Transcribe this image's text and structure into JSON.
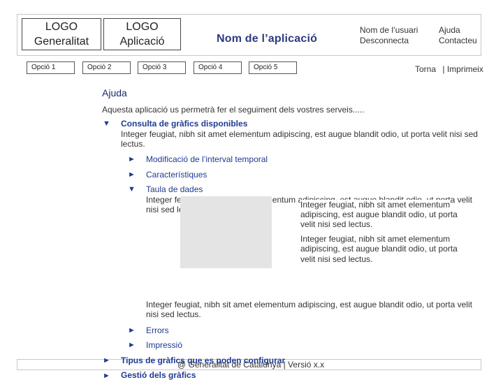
{
  "header": {
    "logo_generalitat": {
      "line1": "LOGO",
      "line2": "Generalitat"
    },
    "logo_aplicacio": {
      "line1": "LOGO",
      "line2": "Aplicació"
    },
    "app_title": "Nom de l’aplicació",
    "user": {
      "username": "Nom de l’usuari",
      "logout": "Desconnecta",
      "help": "Ajuda",
      "contact": "Contacteu"
    }
  },
  "nav": {
    "tabs": [
      {
        "label": "Opció 1"
      },
      {
        "label": "Opció 2"
      },
      {
        "label": "Opció 3"
      },
      {
        "label": "Opció 4"
      },
      {
        "label": "Opció 5"
      }
    ],
    "back": "Torna",
    "separator": "|",
    "print": "Imprimeix"
  },
  "help": {
    "title": "Ajuda",
    "intro": "Aquesta aplicació us permetrà fer el seguiment dels vostres serveis.....",
    "sections": {
      "consulta": {
        "arrow": "▼",
        "title": "Consulta de gràfics disponibles",
        "body_line1": "Integer feugiat, nibh sit amet elementum adipiscing, est augue blandit odio, ut porta velit nisi sed",
        "body_line2": "lectus."
      },
      "modificacio": {
        "arrow": "►",
        "label": "Modificació de l’interval temporal"
      },
      "caracteristiques": {
        "arrow": "►",
        "label": "Característiques"
      },
      "taula": {
        "arrow": "▼",
        "label": "Taula de dades",
        "back_line1": "Integer feugiat, nibh sit amet elementum adipiscing, est augue blandit odio, ut porta velit",
        "back_line2": "nisi sed lectus.",
        "col_p1_l1": "Integer feugiat, nibh sit amet elementum",
        "col_p1_l2": "adipiscing, est augue blandit odio, ut porta",
        "col_p1_l3": "velit nisi sed lectus.",
        "col_p2_l1": "Integer feugiat, nibh sit amet elementum",
        "col_p2_l2": "adipiscing, est augue blandit odio, ut porta",
        "col_p2_l3": "velit nisi sed lectus.",
        "after_line1": "Integer feugiat, nibh sit amet elementum adipiscing, est augue blandit odio, ut porta velit",
        "after_line2": "nisi sed lectus."
      },
      "errors": {
        "arrow": "►",
        "label": "Errors"
      },
      "impressio": {
        "arrow": "►",
        "label": "Impressió"
      },
      "tipus": {
        "arrow": "►",
        "label": "Tipus de gràfics que es poden configurar"
      },
      "gestio": {
        "arrow": "►",
        "label": "Gestió dels gràfics"
      }
    }
  },
  "footer": {
    "copyright": "@ Generalitat de Catalunya | Versió x.x"
  }
}
